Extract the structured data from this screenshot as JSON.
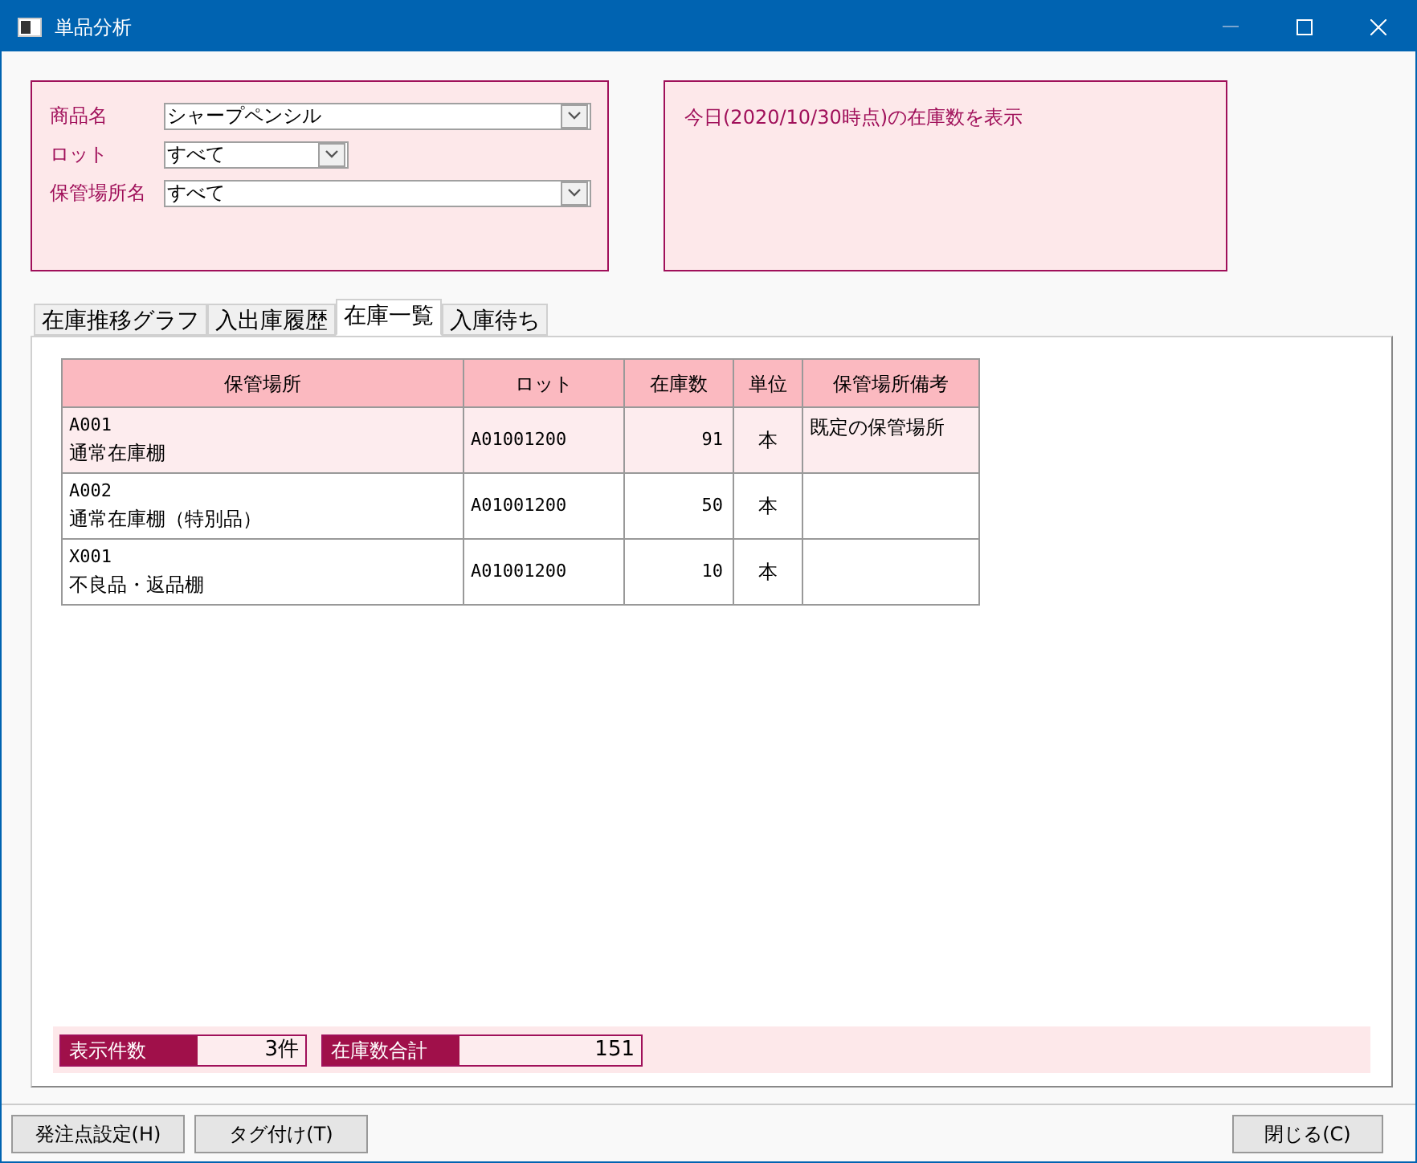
{
  "window": {
    "title": "単品分析"
  },
  "filters": [
    {
      "label": "商品名",
      "value": "シャープペンシル",
      "kind": "wide"
    },
    {
      "label": "ロット",
      "value": "すべて",
      "kind": "narrow"
    },
    {
      "label": "保管場所名",
      "value": "すべて",
      "kind": "wide"
    }
  ],
  "info": "今日(2020/10/30時点)の在庫数を表示",
  "tabs": [
    {
      "label": "在庫推移グラフ",
      "selected": false
    },
    {
      "label": "入出庫履歴",
      "selected": false
    },
    {
      "label": "在庫一覧",
      "selected": true
    },
    {
      "label": "入庫待ち",
      "selected": false
    }
  ],
  "table": {
    "columns": [
      "保管場所",
      "ロット",
      "在庫数",
      "単位",
      "保管場所備考"
    ],
    "rows": [
      {
        "location_code": "A001",
        "location_name": "通常在庫棚",
        "lot": "A01001200",
        "qty": "91",
        "unit": "本",
        "note": "既定の保管場所",
        "selected": true
      },
      {
        "location_code": "A002",
        "location_name": "通常在庫棚（特別品）",
        "lot": "A01001200",
        "qty": "50",
        "unit": "本",
        "note": "",
        "selected": false
      },
      {
        "location_code": "X001",
        "location_name": "不良品・返品棚",
        "lot": "A01001200",
        "qty": "10",
        "unit": "本",
        "note": "",
        "selected": false
      }
    ]
  },
  "summary": [
    {
      "label": "表示件数",
      "value": "3件"
    },
    {
      "label": "在庫数合計",
      "value": "151"
    }
  ],
  "buttons_left": [
    "発注点設定(H)",
    "タグ付け(T)"
  ],
  "buttons_right": [
    "閉じる(C)"
  ]
}
